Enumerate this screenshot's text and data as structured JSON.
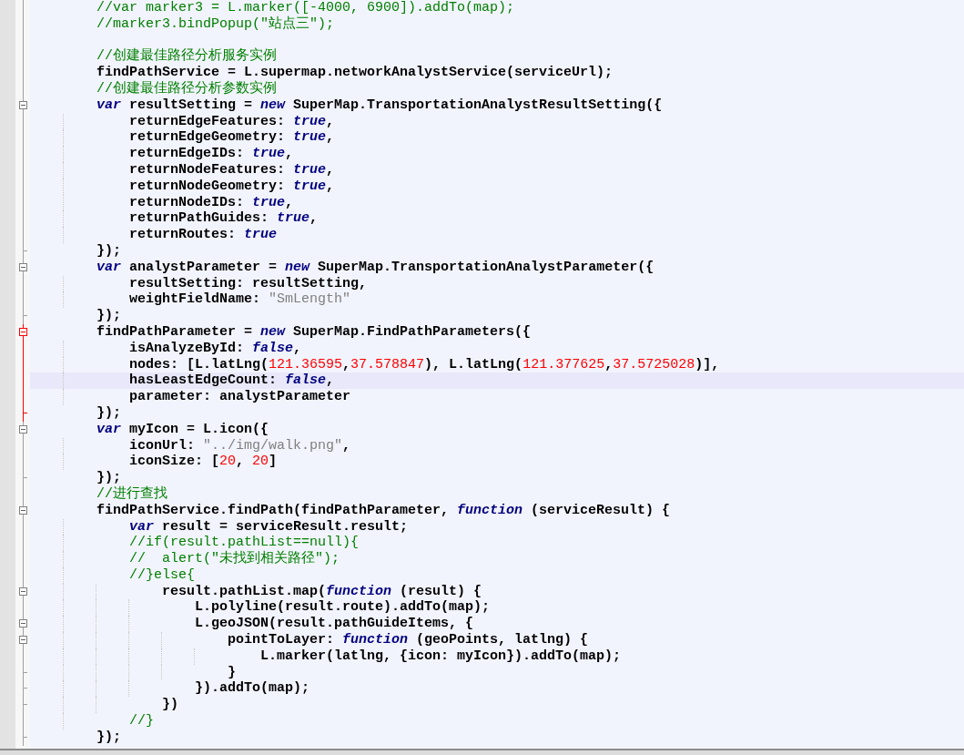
{
  "editor": {
    "lines": [
      {
        "tokens": [
          {
            "kind": "comment",
            "text": "        //var marker3 = L.marker([-4000, 6900]).addTo(map);"
          }
        ],
        "collapsible": false,
        "block_end": false,
        "marked": false,
        "current": false
      },
      {
        "tokens": [
          {
            "kind": "comment",
            "text": "        //marker3.bindPopup(\"站点三\");"
          }
        ],
        "collapsible": false,
        "block_end": false,
        "marked": false,
        "current": false
      },
      {
        "collapsible": false,
        "block_end": false,
        "marked": false,
        "current": false
      },
      {
        "tokens": [
          {
            "kind": "comment",
            "text": "        //创建最佳路径分析服务实例"
          }
        ],
        "collapsible": false,
        "block_end": false,
        "marked": false,
        "current": false
      },
      {
        "tokens": [
          {
            "kind": "plain",
            "text": "        findPathService = L.supermap.networkAnalystService(serviceUrl);"
          }
        ],
        "collapsible": false,
        "block_end": false,
        "marked": false,
        "current": false
      },
      {
        "tokens": [
          {
            "kind": "comment",
            "text": "        //创建最佳路径分析参数实例"
          }
        ],
        "collapsible": false,
        "block_end": false,
        "marked": false,
        "current": false
      },
      {
        "tokens": [
          {
            "kind": "keyword",
            "text": "        var"
          },
          {
            "kind": "plain",
            "text": " resultSetting = "
          },
          {
            "kind": "keyword",
            "text": "new"
          },
          {
            "kind": "plain",
            "text": " SuperMap.TransportationAnalystResultSetting({"
          }
        ],
        "collapsible": true,
        "block_end": false,
        "marked": false,
        "current": false
      },
      {
        "tokens": [
          {
            "kind": "plain",
            "text": "            returnEdgeFeatures: "
          },
          {
            "kind": "bool",
            "text": "true"
          },
          {
            "kind": "plain",
            "text": ","
          }
        ],
        "collapsible": false,
        "block_end": false,
        "marked": false,
        "current": false
      },
      {
        "tokens": [
          {
            "kind": "plain",
            "text": "            returnEdgeGeometry: "
          },
          {
            "kind": "bool",
            "text": "true"
          },
          {
            "kind": "plain",
            "text": ","
          }
        ],
        "collapsible": false,
        "block_end": false,
        "marked": false,
        "current": false
      },
      {
        "tokens": [
          {
            "kind": "plain",
            "text": "            returnEdgeIDs: "
          },
          {
            "kind": "bool",
            "text": "true"
          },
          {
            "kind": "plain",
            "text": ","
          }
        ],
        "collapsible": false,
        "block_end": false,
        "marked": false,
        "current": false
      },
      {
        "tokens": [
          {
            "kind": "plain",
            "text": "            returnNodeFeatures: "
          },
          {
            "kind": "bool",
            "text": "true"
          },
          {
            "kind": "plain",
            "text": ","
          }
        ],
        "collapsible": false,
        "block_end": false,
        "marked": false,
        "current": false
      },
      {
        "tokens": [
          {
            "kind": "plain",
            "text": "            returnNodeGeometry: "
          },
          {
            "kind": "bool",
            "text": "true"
          },
          {
            "kind": "plain",
            "text": ","
          }
        ],
        "collapsible": false,
        "block_end": false,
        "marked": false,
        "current": false
      },
      {
        "tokens": [
          {
            "kind": "plain",
            "text": "            returnNodeIDs: "
          },
          {
            "kind": "bool",
            "text": "true"
          },
          {
            "kind": "plain",
            "text": ","
          }
        ],
        "collapsible": false,
        "block_end": false,
        "marked": false,
        "current": false
      },
      {
        "tokens": [
          {
            "kind": "plain",
            "text": "            returnPathGuides: "
          },
          {
            "kind": "bool",
            "text": "true"
          },
          {
            "kind": "plain",
            "text": ","
          }
        ],
        "collapsible": false,
        "block_end": false,
        "marked": false,
        "current": false
      },
      {
        "tokens": [
          {
            "kind": "plain",
            "text": "            returnRoutes: "
          },
          {
            "kind": "bool",
            "text": "true"
          }
        ],
        "collapsible": false,
        "block_end": false,
        "marked": false,
        "current": false
      },
      {
        "tokens": [
          {
            "kind": "plain",
            "text": "        });"
          }
        ],
        "collapsible": false,
        "block_end": true,
        "marked": false,
        "current": false
      },
      {
        "tokens": [
          {
            "kind": "keyword",
            "text": "        var"
          },
          {
            "kind": "plain",
            "text": " analystParameter = "
          },
          {
            "kind": "keyword",
            "text": "new"
          },
          {
            "kind": "plain",
            "text": " SuperMap.TransportationAnalystParameter({"
          }
        ],
        "collapsible": true,
        "block_end": false,
        "marked": false,
        "current": false
      },
      {
        "tokens": [
          {
            "kind": "plain",
            "text": "            resultSetting: resultSetting,"
          }
        ],
        "collapsible": false,
        "block_end": false,
        "marked": false,
        "current": false
      },
      {
        "tokens": [
          {
            "kind": "plain",
            "text": "            weightFieldName: "
          },
          {
            "kind": "string",
            "text": "\"SmLength\""
          }
        ],
        "collapsible": false,
        "block_end": false,
        "marked": false,
        "current": false
      },
      {
        "tokens": [
          {
            "kind": "plain",
            "text": "        });"
          }
        ],
        "collapsible": false,
        "block_end": true,
        "marked": false,
        "current": false
      },
      {
        "tokens": [
          {
            "kind": "plain",
            "text": "        findPathParameter = "
          },
          {
            "kind": "keyword",
            "text": "new"
          },
          {
            "kind": "plain",
            "text": " SuperMap.FindPathParameters({"
          }
        ],
        "collapsible": true,
        "block_end": false,
        "marked": true,
        "current": false
      },
      {
        "tokens": [
          {
            "kind": "plain",
            "text": "            isAnalyzeById: "
          },
          {
            "kind": "bool",
            "text": "false"
          },
          {
            "kind": "plain",
            "text": ","
          }
        ],
        "collapsible": false,
        "block_end": false,
        "marked": true,
        "current": false
      },
      {
        "tokens": [
          {
            "kind": "plain",
            "text": "            nodes: [L.latLng("
          },
          {
            "kind": "number",
            "text": "121.36595"
          },
          {
            "kind": "plain",
            "text": ","
          },
          {
            "kind": "number",
            "text": "37.578847"
          },
          {
            "kind": "plain",
            "text": "), L.latLng("
          },
          {
            "kind": "number",
            "text": "121.377625"
          },
          {
            "kind": "plain",
            "text": ","
          },
          {
            "kind": "number",
            "text": "37.5725028"
          },
          {
            "kind": "plain",
            "text": ")],"
          }
        ],
        "collapsible": false,
        "block_end": false,
        "marked": true,
        "current": false
      },
      {
        "tokens": [
          {
            "kind": "plain",
            "text": "            hasLeastEdgeCount: "
          },
          {
            "kind": "bool",
            "text": "false"
          },
          {
            "kind": "plain",
            "text": ","
          }
        ],
        "collapsible": false,
        "block_end": false,
        "marked": true,
        "current": true
      },
      {
        "tokens": [
          {
            "kind": "plain",
            "text": "            parameter: analystParameter"
          }
        ],
        "collapsible": false,
        "block_end": false,
        "marked": true,
        "current": false
      },
      {
        "tokens": [
          {
            "kind": "plain",
            "text": "        });"
          }
        ],
        "collapsible": false,
        "block_end": true,
        "marked": true,
        "current": false
      },
      {
        "tokens": [
          {
            "kind": "keyword",
            "text": "        var"
          },
          {
            "kind": "plain",
            "text": " myIcon = L.icon({"
          }
        ],
        "collapsible": true,
        "block_end": false,
        "marked": false,
        "current": false
      },
      {
        "tokens": [
          {
            "kind": "plain",
            "text": "            iconUrl: "
          },
          {
            "kind": "string",
            "text": "\"../img/walk.png\""
          },
          {
            "kind": "plain",
            "text": ","
          }
        ],
        "collapsible": false,
        "block_end": false,
        "marked": false,
        "current": false
      },
      {
        "tokens": [
          {
            "kind": "plain",
            "text": "            iconSize: ["
          },
          {
            "kind": "number",
            "text": "20"
          },
          {
            "kind": "plain",
            "text": ", "
          },
          {
            "kind": "number",
            "text": "20"
          },
          {
            "kind": "plain",
            "text": "]"
          }
        ],
        "collapsible": false,
        "block_end": false,
        "marked": false,
        "current": false
      },
      {
        "tokens": [
          {
            "kind": "plain",
            "text": "        });"
          }
        ],
        "collapsible": false,
        "block_end": true,
        "marked": false,
        "current": false
      },
      {
        "tokens": [
          {
            "kind": "comment",
            "text": "        //进行查找"
          }
        ],
        "collapsible": false,
        "block_end": false,
        "marked": false,
        "current": false
      },
      {
        "tokens": [
          {
            "kind": "plain",
            "text": "        findPathService.findPath(findPathParameter, "
          },
          {
            "kind": "keyword",
            "text": "function"
          },
          {
            "kind": "plain",
            "text": " (serviceResult) {"
          }
        ],
        "collapsible": true,
        "block_end": false,
        "marked": false,
        "current": false
      },
      {
        "tokens": [
          {
            "kind": "keyword",
            "text": "            var"
          },
          {
            "kind": "plain",
            "text": " result = serviceResult.result;"
          }
        ],
        "collapsible": false,
        "block_end": false,
        "marked": false,
        "current": false
      },
      {
        "tokens": [
          {
            "kind": "comment",
            "text": "            //if(result.pathList==null){"
          }
        ],
        "collapsible": false,
        "block_end": false,
        "marked": false,
        "current": false
      },
      {
        "tokens": [
          {
            "kind": "comment",
            "text": "            //  alert(\"未找到相关路径\");"
          }
        ],
        "collapsible": false,
        "block_end": false,
        "marked": false,
        "current": false
      },
      {
        "tokens": [
          {
            "kind": "comment",
            "text": "            //}else{"
          }
        ],
        "collapsible": false,
        "block_end": false,
        "marked": false,
        "current": false
      },
      {
        "tokens": [
          {
            "kind": "plain",
            "text": "                result.pathList.map("
          },
          {
            "kind": "keyword",
            "text": "function"
          },
          {
            "kind": "plain",
            "text": " (result) {"
          }
        ],
        "collapsible": true,
        "block_end": false,
        "marked": false,
        "current": false
      },
      {
        "tokens": [
          {
            "kind": "plain",
            "text": "                    L.polyline(result.route).addTo(map);"
          }
        ],
        "collapsible": false,
        "block_end": false,
        "marked": false,
        "current": false
      },
      {
        "tokens": [
          {
            "kind": "plain",
            "text": "                    L.geoJSON(result.pathGuideItems, {"
          }
        ],
        "collapsible": true,
        "block_end": false,
        "marked": false,
        "current": false
      },
      {
        "tokens": [
          {
            "kind": "plain",
            "text": "                        pointToLayer: "
          },
          {
            "kind": "keyword",
            "text": "function"
          },
          {
            "kind": "plain",
            "text": " (geoPoints, latlng) {"
          }
        ],
        "collapsible": true,
        "block_end": false,
        "marked": false,
        "current": false
      },
      {
        "tokens": [
          {
            "kind": "plain",
            "text": "                            L.marker(latlng, {icon: myIcon}).addTo(map);"
          }
        ],
        "collapsible": false,
        "block_end": false,
        "marked": false,
        "current": false
      },
      {
        "tokens": [
          {
            "kind": "plain",
            "text": "                        }"
          }
        ],
        "collapsible": false,
        "block_end": true,
        "marked": false,
        "current": false
      },
      {
        "tokens": [
          {
            "kind": "plain",
            "text": "                    }).addTo(map);"
          }
        ],
        "collapsible": false,
        "block_end": true,
        "marked": false,
        "current": false
      },
      {
        "tokens": [
          {
            "kind": "plain",
            "text": "                })"
          }
        ],
        "collapsible": false,
        "block_end": true,
        "marked": false,
        "current": false
      },
      {
        "tokens": [
          {
            "kind": "comment",
            "text": "            //}"
          }
        ],
        "collapsible": false,
        "block_end": false,
        "marked": false,
        "current": false
      },
      {
        "tokens": [
          {
            "kind": "plain",
            "text": "        });"
          }
        ],
        "collapsible": false,
        "block_end": true,
        "marked": false,
        "current": false
      }
    ]
  }
}
